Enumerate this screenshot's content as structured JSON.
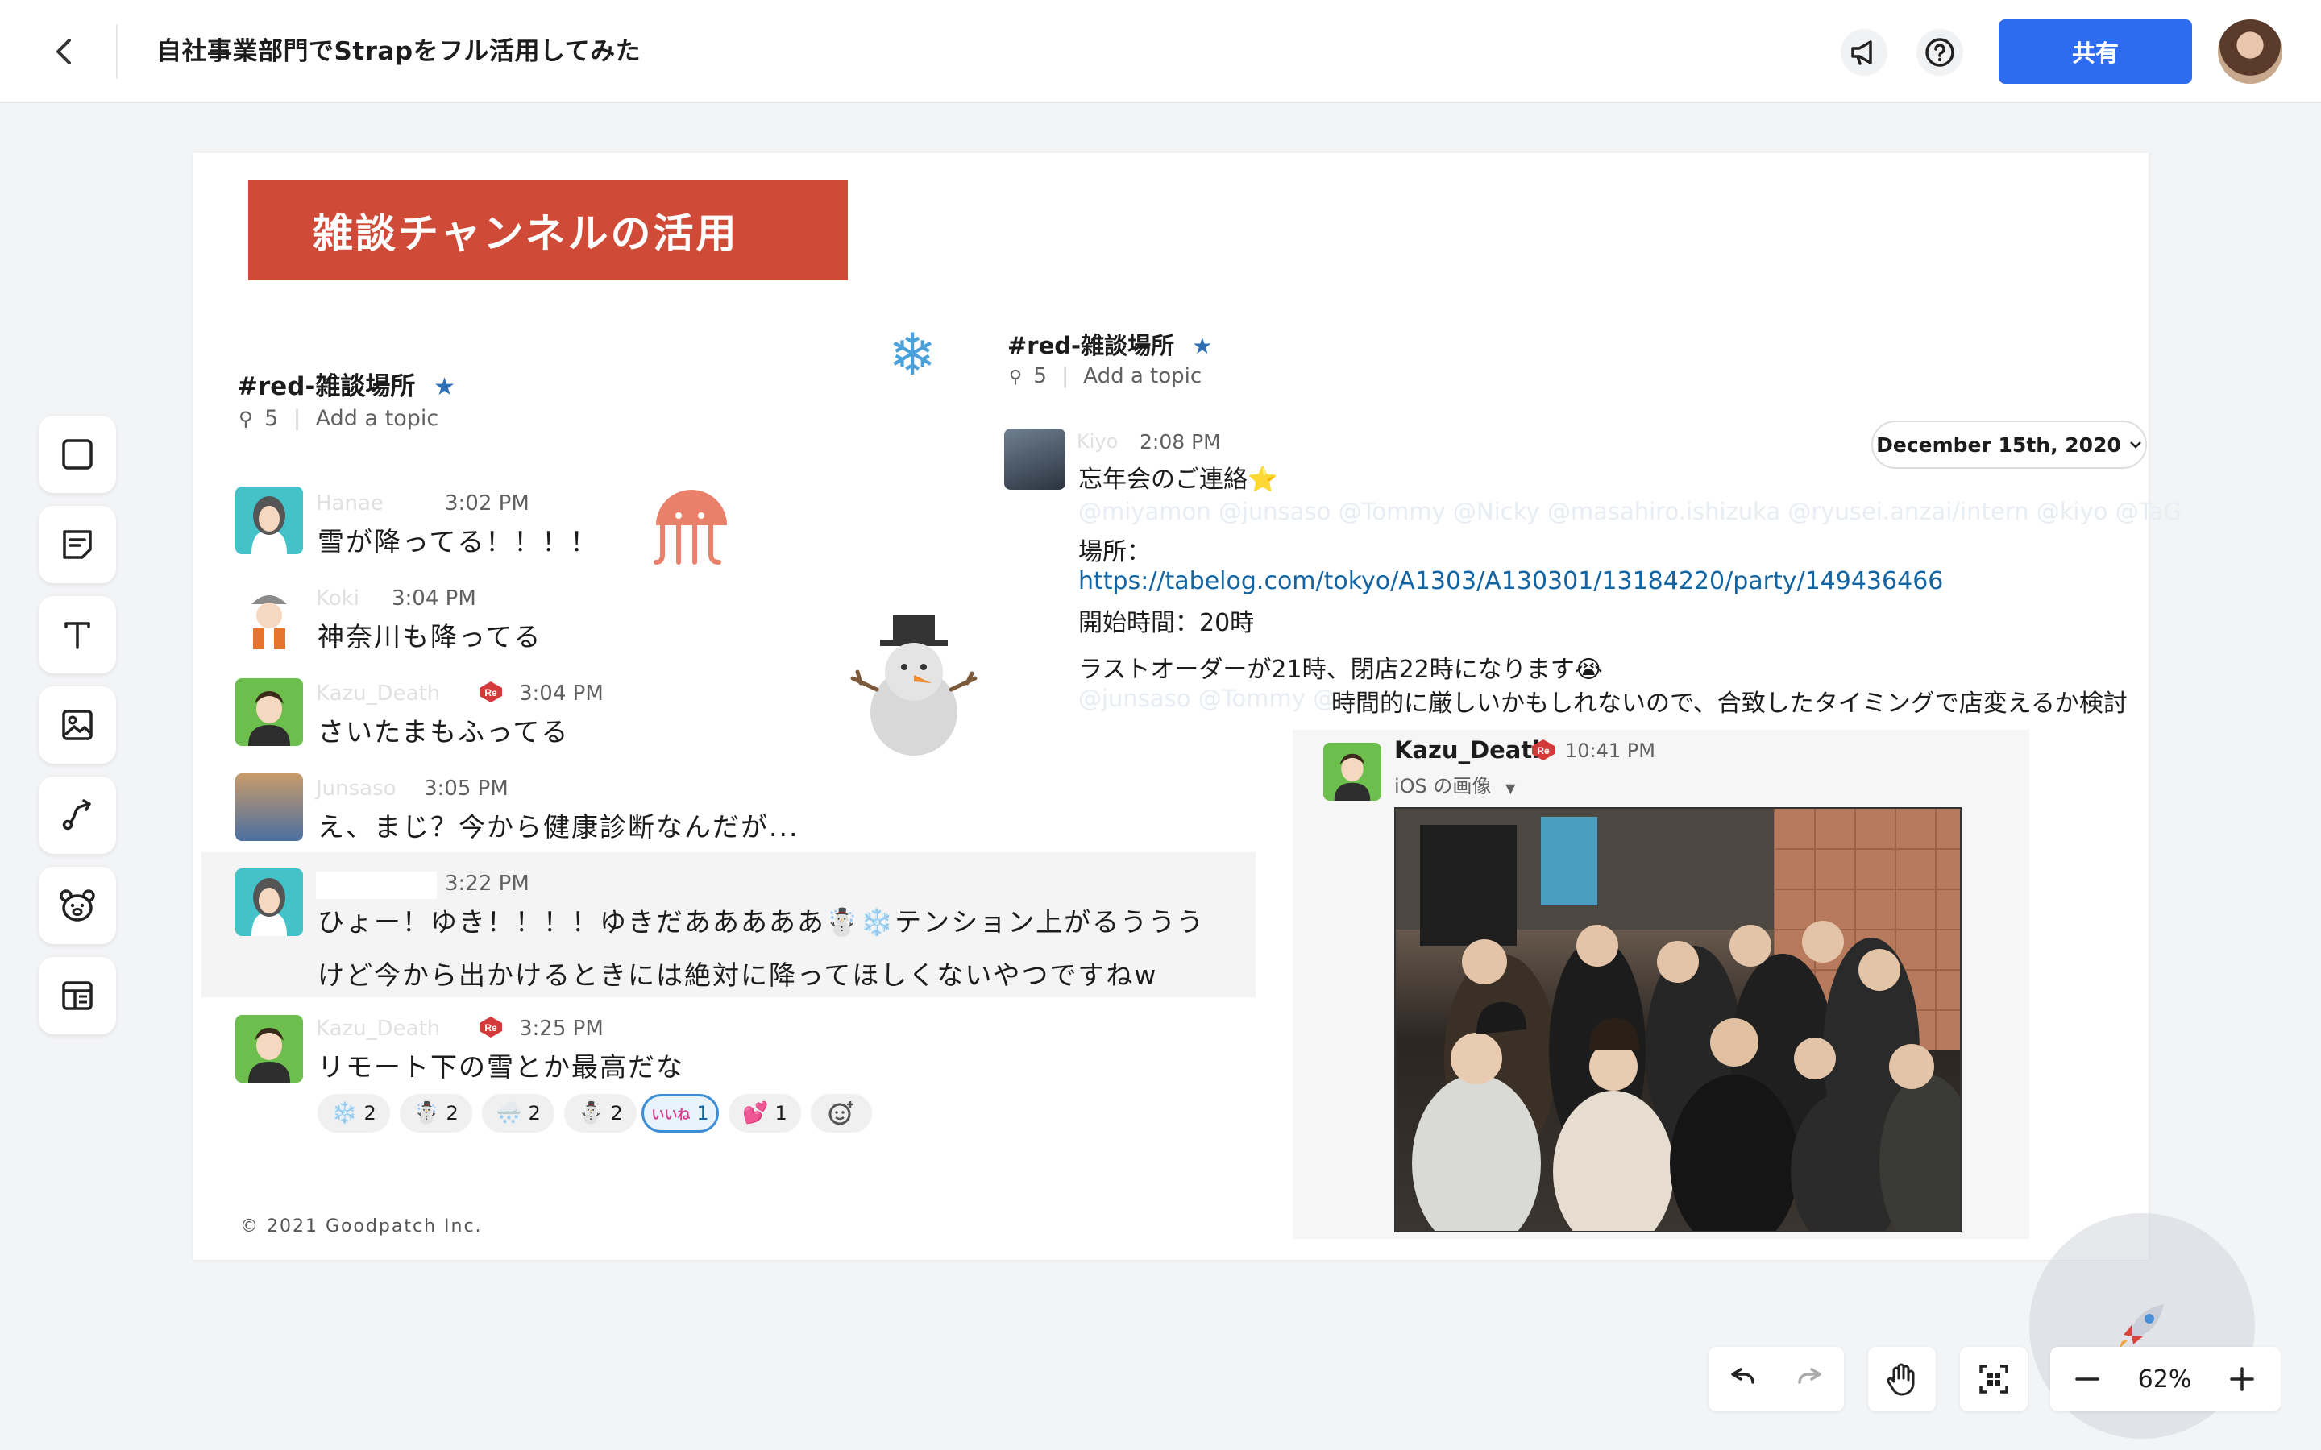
{
  "header": {
    "title": "自社事業部門でStrapをフル活用してみた",
    "share_label": "共有"
  },
  "slide": {
    "banner": "雑談チャンネルの活用",
    "copyright": "© 2021 Goodpatch Inc."
  },
  "left_chat": {
    "channel": "#red-雑談場所",
    "pins": "5",
    "topic": "Add a topic",
    "messages": [
      {
        "time": "3:02 PM",
        "text": "雪が降ってる！！！！"
      },
      {
        "time": "3:04 PM",
        "text": "神奈川も降ってる"
      },
      {
        "time": "3:04 PM",
        "text": "さいたまもふってる"
      },
      {
        "time": "3:05 PM",
        "text": "え、まじ？今から健康診断なんだが..."
      },
      {
        "time": "3:22 PM",
        "text": "ひょー！ゆき！！！！ゆきだあああああ☃️❄️テンション上がるううう",
        "text2": "けど今から出かけるときには絶対に降ってほしくないやつですねw"
      },
      {
        "time": "3:25 PM",
        "text": "リモート下の雪とか最高だな"
      }
    ],
    "reactions": [
      {
        "emoji": "❄️",
        "count": "2"
      },
      {
        "emoji": "☃️",
        "count": "2"
      },
      {
        "emoji": "🌨️",
        "count": "2"
      },
      {
        "emoji": "⛄",
        "count": "2"
      },
      {
        "emoji": "いいね",
        "count": "1"
      },
      {
        "emoji": "💕",
        "count": "1"
      }
    ]
  },
  "right_chat": {
    "channel": "#red-雑談場所",
    "pins": "5",
    "topic": "Add a topic",
    "date": "December 15th, 2020",
    "msg_time": "2:08 PM",
    "line1": "忘年会のご連絡⭐",
    "mentions": "@miyamon  @junsaso  @Tommy  @Nicky  @masahiro.ishizuka  @ryusei.anzai/intern  @kiyo  @TaG",
    "place_label": "場所：",
    "url": "https://tabelog.com/tokyo/A1303/A130301/13184220/party/149436466",
    "start": "開始時間：20時",
    "last_order": "ラストオーダーが21時、閉店22時になります😭",
    "mentions2": "@junsaso  @Tommy  @",
    "tail": "時間的に厳しいかもしれないので、合致したタイミングで店変えるか検討",
    "post_name": "Kazu_Death",
    "post_time": "10:41 PM",
    "post_sub": "iOS の画像"
  },
  "controls": {
    "zoom": "62%"
  }
}
